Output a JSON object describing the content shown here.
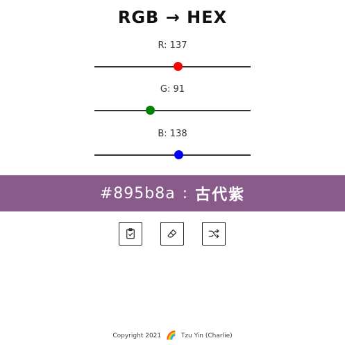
{
  "app": {
    "title": "RGB → HEX"
  },
  "sliders": {
    "r": {
      "label": "R: 137",
      "value": 137,
      "max": 255,
      "color": "#ff0000"
    },
    "g": {
      "label": "G: 91",
      "value": 91,
      "max": 255,
      "color": "#008000"
    },
    "b": {
      "label": "B: 138",
      "value": 138,
      "max": 255,
      "color": "#0000ff"
    }
  },
  "result": {
    "hex": "#895b8a",
    "separator": ":",
    "color_name": "古代紫",
    "background": "#895b8a"
  },
  "buttons": {
    "copy_icon": "clipboard-check-icon",
    "clear_icon": "eraser-icon",
    "random_icon": "shuffle-icon"
  },
  "footer": {
    "copyright": "Copyright 2021",
    "emoji": "🌈",
    "author": "Tzu Yin (Charlie)"
  }
}
